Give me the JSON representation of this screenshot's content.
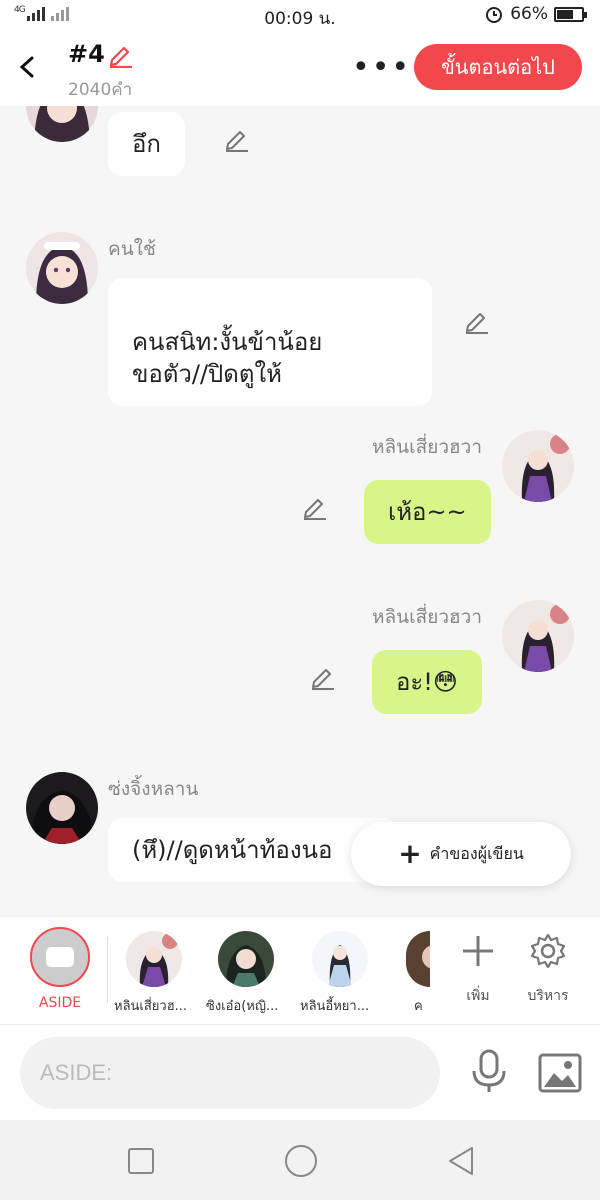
{
  "status_bar": {
    "signal_text": "4G",
    "time": "00:09 น.",
    "battery_percent": "66%",
    "battery_level": 0.66
  },
  "header": {
    "title": "#4",
    "word_count": "2040คำ",
    "next_button": "ขั้นตอนต่อไป"
  },
  "messages": [
    {
      "side": "left",
      "speaker": "",
      "text": "อึก"
    },
    {
      "side": "left",
      "speaker": "คนใช้",
      "text": "คนสนิท:งั้นข้าน้อย\nขอตัว//ปิดตูให้"
    },
    {
      "side": "right",
      "speaker": "หลินเสี่ยวฮวา",
      "text": "เห้อ~~"
    },
    {
      "side": "right",
      "speaker": "หลินเสี่ยวฮวา",
      "text": "อะ!😳"
    },
    {
      "side": "left",
      "speaker": "ซ่งจิ้งหลาน",
      "text": "(หึ)//ดูดหน้าท้องนอ"
    }
  ],
  "fab": {
    "label": "คำของผู้เขียน"
  },
  "characters": {
    "aside_label": "ASIDE",
    "items": [
      {
        "label": "หลินเสี่ยวฮ..."
      },
      {
        "label": "ซิงเอ๋อ(หญิ..."
      },
      {
        "label": "หลินอี้หยา..."
      },
      {
        "label": "ค"
      }
    ],
    "add_label": "เพิ่ม",
    "manage_label": "บริหาร"
  },
  "input": {
    "placeholder": "ASIDE:"
  },
  "colors": {
    "accent": "#f2474c",
    "right_bubble": "#d8f58a",
    "left_bubble": "#ffffff"
  },
  "icons": [
    "back-icon",
    "pencil-icon",
    "more-icon",
    "plus-icon",
    "gear-icon",
    "mic-icon",
    "image-icon"
  ]
}
